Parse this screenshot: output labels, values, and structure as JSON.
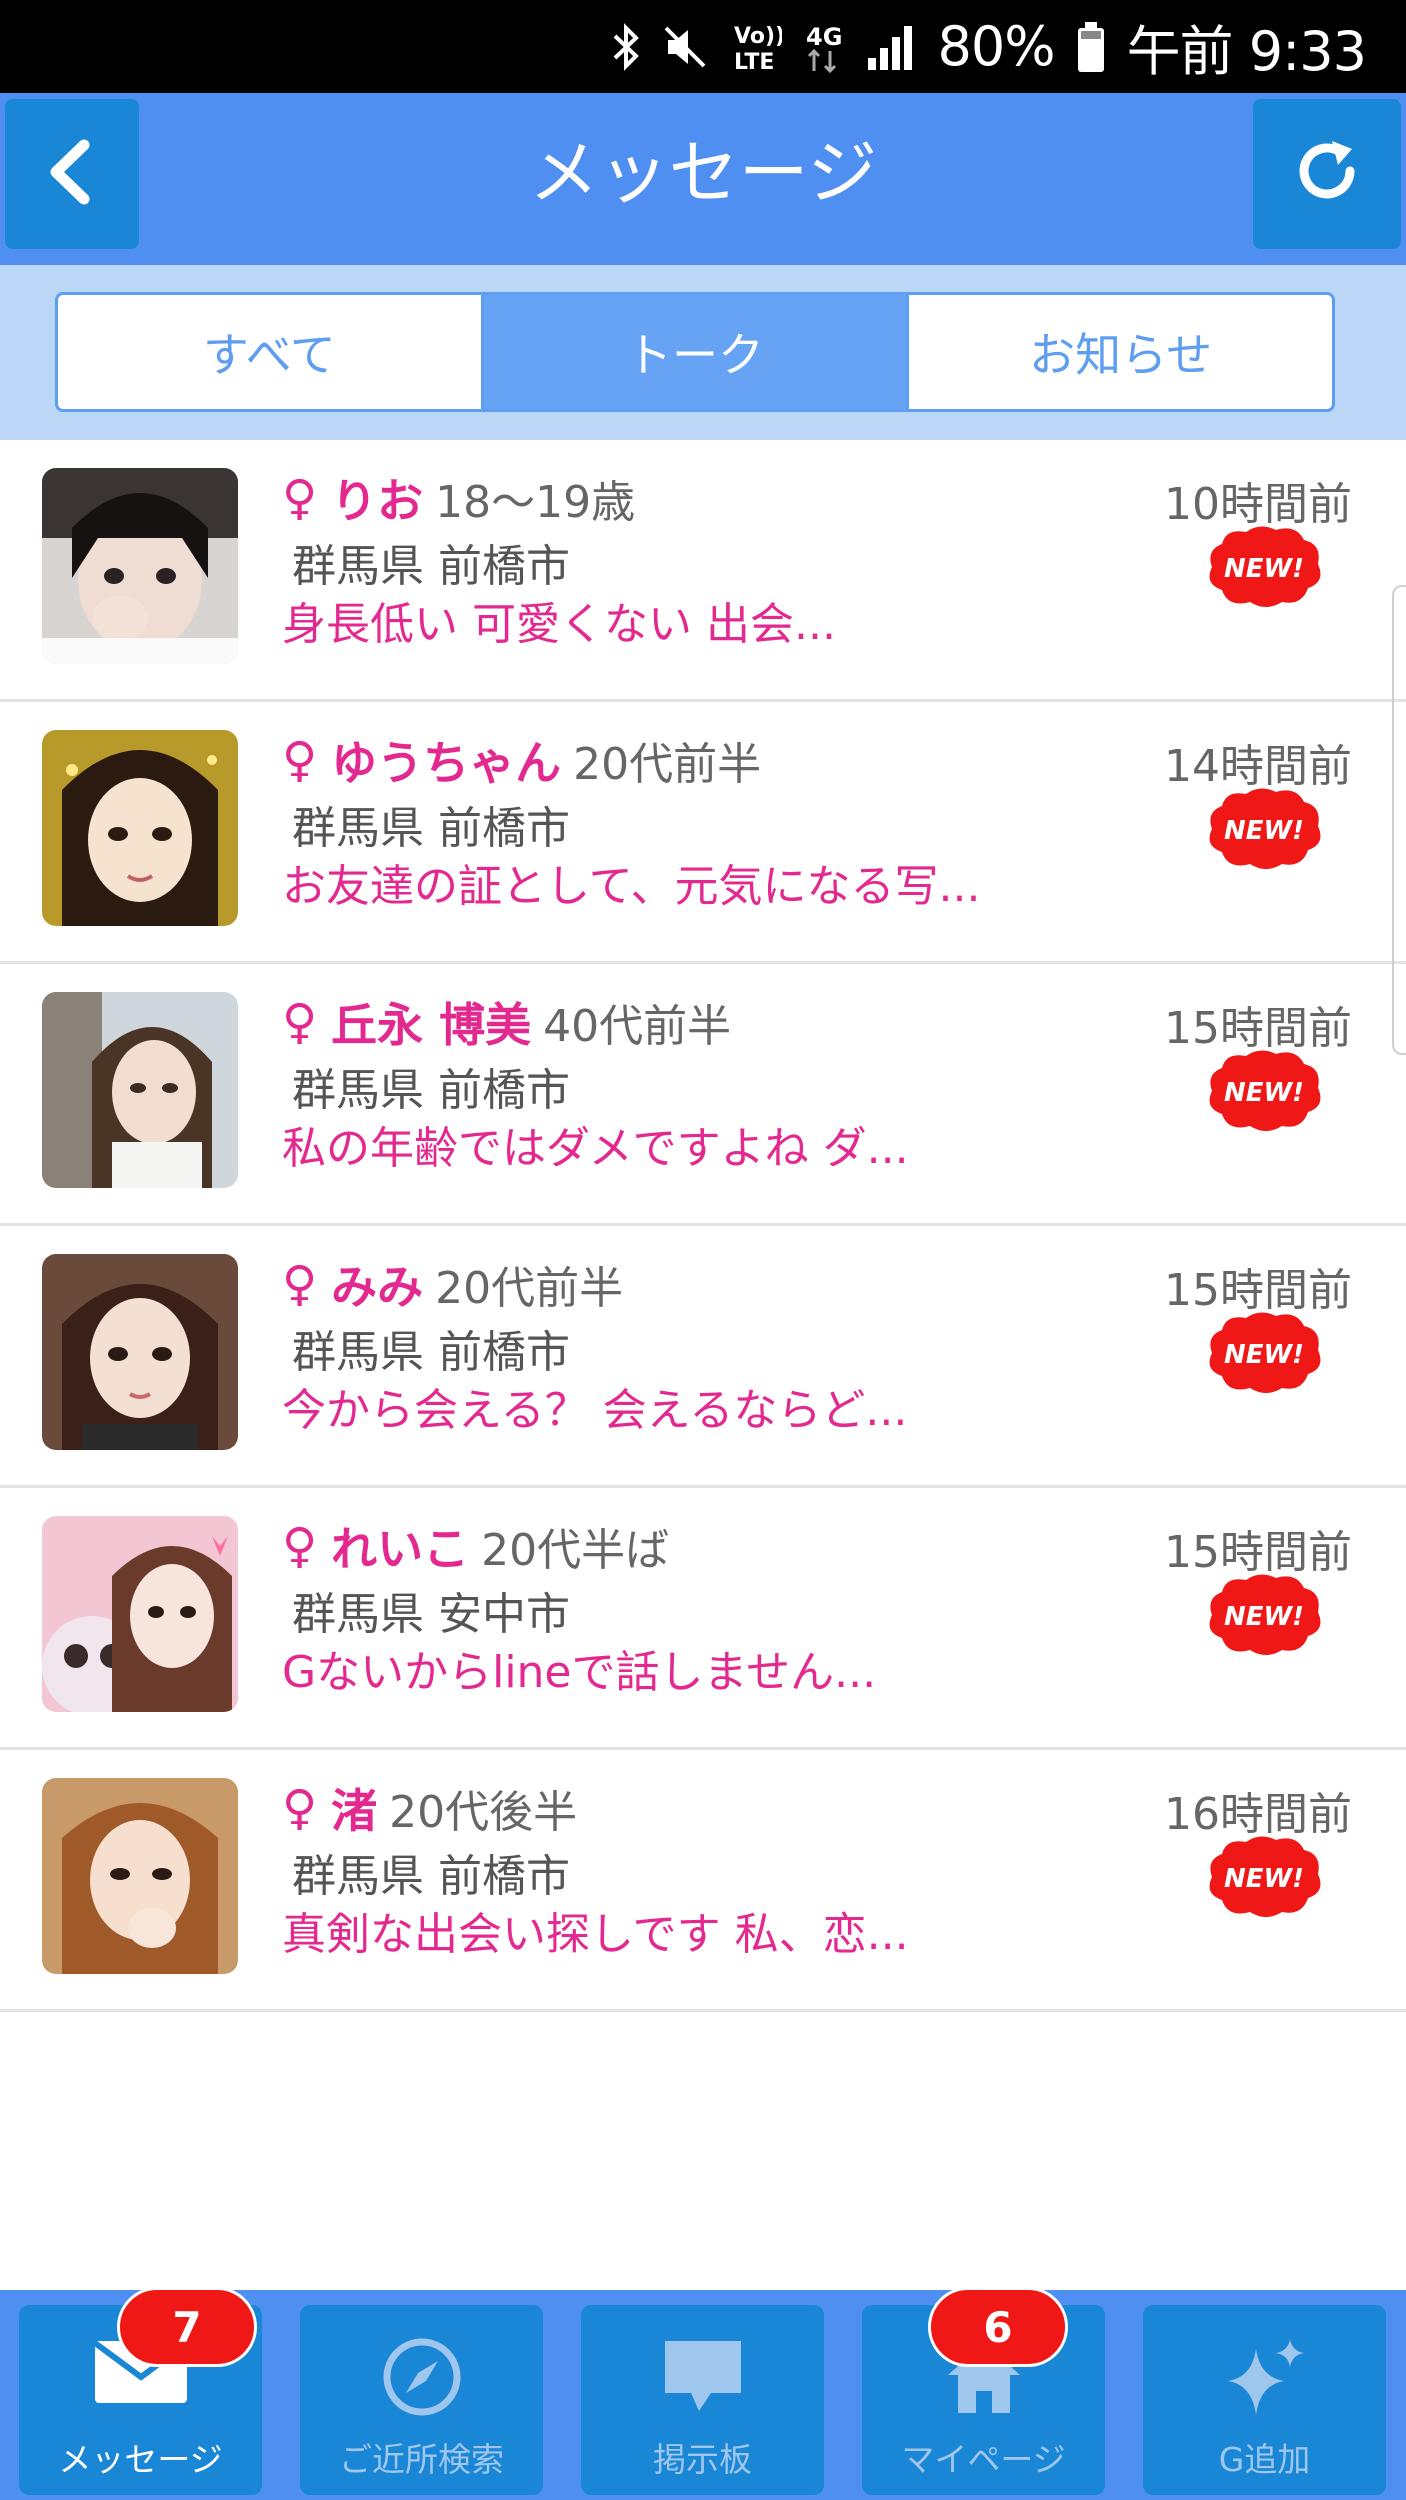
{
  "status_bar": {
    "battery": "80%",
    "time": "午前 9:33",
    "network": "4G",
    "volte": "Vo)) LTE"
  },
  "header": {
    "title": "メッセージ",
    "back_icon": "chevron-left-icon",
    "refresh_icon": "refresh-icon"
  },
  "tabs": [
    {
      "label": "すべて",
      "active": false
    },
    {
      "label": "トーク",
      "active": true
    },
    {
      "label": "お知らせ",
      "active": false
    }
  ],
  "messages": [
    {
      "gender_symbol": "♀",
      "name": "りお",
      "age": "18〜19歳",
      "location": "群馬県 前橋市",
      "preview": "身長低い 可愛くない 出会...",
      "time": "10時間前",
      "badge": "NEW!"
    },
    {
      "gender_symbol": "♀",
      "name": "ゆうちゃん",
      "age": "20代前半",
      "location": "群馬県 前橋市",
      "preview": "お友達の証として、元気になる写...",
      "time": "14時間前",
      "badge": "NEW!"
    },
    {
      "gender_symbol": "♀",
      "name": "丘永 博美",
      "age": "40代前半",
      "location": "群馬県 前橋市",
      "preview": "私の年齢ではダメですよね ダ...",
      "time": "15時間前",
      "badge": "NEW!"
    },
    {
      "gender_symbol": "♀",
      "name": "みみ",
      "age": "20代前半",
      "location": "群馬県 前橋市",
      "preview": "今から会える？ 会えるならど...",
      "time": "15時間前",
      "badge": "NEW!"
    },
    {
      "gender_symbol": "♀",
      "name": "れいこ",
      "age": "20代半ば",
      "location": "群馬県 安中市",
      "preview": "Gないからlineで話しません...",
      "time": "15時間前",
      "badge": "NEW!"
    },
    {
      "gender_symbol": "♀",
      "name": "渚",
      "age": "20代後半",
      "location": "群馬県 前橋市",
      "preview": "真剣な出会い探しです 私、恋...",
      "time": "16時間前",
      "badge": "NEW!"
    }
  ],
  "bottom_nav": [
    {
      "label": "メッセージ",
      "icon": "envelope-icon",
      "badge": "7",
      "active": true
    },
    {
      "label": "ご近所検索",
      "icon": "compass-icon",
      "badge": null,
      "active": false
    },
    {
      "label": "掲示板",
      "icon": "speech-bubble-icon",
      "badge": null,
      "active": false
    },
    {
      "label": "マイページ",
      "icon": "home-icon",
      "badge": "6",
      "active": false
    },
    {
      "label": "G追加",
      "icon": "sparkle-icon",
      "badge": null,
      "active": false
    }
  ],
  "colors": {
    "header_bg": "#4f8ff2",
    "button_bg": "#1a86d6",
    "accent_pink": "#e3298f",
    "badge_red": "#f01717",
    "tab_bg": "#bcd6f8"
  }
}
